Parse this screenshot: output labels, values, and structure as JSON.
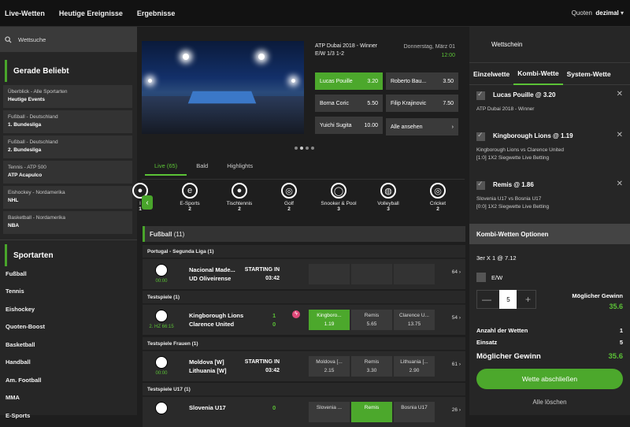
{
  "topnav": {
    "items": [
      "Live-Wetten",
      "Heutige Ereignisse",
      "Ergebnisse"
    ],
    "odds_label": "Quoten",
    "odds_value": "dezimal"
  },
  "sidebar": {
    "search_placeholder": "Wettsuche",
    "popular_title": "Gerade Beliebt",
    "popular": [
      {
        "sub": "Überblick - Alle Sportarten",
        "title": "Heutige Events"
      },
      {
        "sub": "Fußball - Deutschland",
        "title": "1. Bundesliga"
      },
      {
        "sub": "Fußball - Deutschland",
        "title": "2. Bundesliga"
      },
      {
        "sub": "Tennis - ATP 500",
        "title": "ATP Acapulco"
      },
      {
        "sub": "Eishockey - Nordamerika",
        "title": "NHL"
      },
      {
        "sub": "Basketball - Nordamerika",
        "title": "NBA"
      }
    ],
    "sports_title": "Sportarten",
    "sports": [
      "Fußball",
      "Tennis",
      "Eishockey",
      "Quoten-Boost",
      "Basketball",
      "Handball",
      "Am. Football",
      "MMA",
      "E-Sports"
    ]
  },
  "featured": {
    "title": "ATP Dubai 2018 - Winner",
    "subtitle": "E/W 1/3 1-2",
    "date": "Donnerstag, März 01",
    "time": "12:00",
    "odds": [
      {
        "name": "Lucas Pouille",
        "odd": "3.20"
      },
      {
        "name": "Roberto Bau...",
        "odd": "3.50"
      },
      {
        "name": "Borna Coric",
        "odd": "5.50"
      },
      {
        "name": "Filip Krajinovic",
        "odd": "7.50"
      },
      {
        "name": "Yuichi Sugita",
        "odd": "10.00"
      }
    ],
    "see_all": "Alle ansehen"
  },
  "tabs": [
    "Live (65)",
    "Bald",
    "Highlights"
  ],
  "sports_row": [
    {
      "name": "E-Sports",
      "count": "2"
    },
    {
      "name": "Tischtennis",
      "count": "2"
    },
    {
      "name": "Golf",
      "count": "2"
    },
    {
      "name": "Snooker & Pool",
      "count": "3"
    },
    {
      "name": "Volleyball",
      "count": "3"
    },
    {
      "name": "Cricket",
      "count": "2"
    }
  ],
  "sports_row_partial": {
    "name": "l",
    "count": "1"
  },
  "league": {
    "name": "Fußball",
    "count": "(11)"
  },
  "categories": [
    "Portugal - Segunda Liga (1)",
    "Testspiele (1)",
    "Testspiele Frauen (1)",
    "Testspiele U17 (1)"
  ],
  "matches": [
    {
      "home": "Nacional Made...",
      "away": "UD Oliveirense",
      "status1": "STARTING IN",
      "status2": "03:42",
      "clock": "00:00",
      "odds": [],
      "more": "64"
    },
    {
      "home": "Kingborough Lions",
      "away": "Clarence United",
      "score1": "1",
      "score2": "0",
      "clock": "2. HZ 66:15",
      "odds": [
        {
          "label": "Kingboro...",
          "odd": "1.19"
        },
        {
          "label": "Remis",
          "odd": "5.65"
        },
        {
          "label": "Clarence U...",
          "odd": "13.75"
        }
      ],
      "more": "54"
    },
    {
      "home": "Moldova [W]",
      "away": "Lithuania [W]",
      "status1": "STARTING IN",
      "status2": "03:42",
      "clock": "00:00",
      "odds": [
        {
          "label": "Moldova [...",
          "odd": "2.15"
        },
        {
          "label": "Remis",
          "odd": "3.30"
        },
        {
          "label": "Lithuania [...",
          "odd": "2.90"
        }
      ],
      "more": "61"
    },
    {
      "home": "Slovenia U17",
      "away": "",
      "score1": "0",
      "score2": "",
      "clock": "",
      "odds": [
        {
          "label": "Slovenia ...",
          "odd": ""
        },
        {
          "label": "Remis",
          "odd": ""
        },
        {
          "label": "Bosnia U17",
          "odd": ""
        }
      ],
      "more": "26"
    }
  ],
  "betslip": {
    "title": "Wettschein",
    "tabs": [
      "Einzelwette",
      "Kombi-Wette",
      "System-Wette"
    ],
    "bets": [
      {
        "name": "Lucas Pouille @ 3.20",
        "line1": "ATP Dubai 2018 - Winner",
        "line2": ""
      },
      {
        "name": "Kingborough Lions @ 1.19",
        "line1": "Kingborough Lions vs Clarence United",
        "line2": "[1:0] 1X2 Siegwette Live Betting"
      },
      {
        "name": "Remis @ 1.86",
        "line1": "Slovenia U17 vs Bosnia U17",
        "line2": "[0:0] 1X2 Siegwette Live Betting"
      }
    ],
    "options_title": "Kombi-Wetten Optionen",
    "combo": "3er X 1 @ 7.12",
    "ew_label": "E/W",
    "stake": "5",
    "possible_win_label": "Möglicher Gewinn",
    "possible_win": "35.6",
    "count_label": "Anzahl der Wetten",
    "count": "1",
    "stake_label": "Einsatz",
    "stake_total": "5",
    "total_win_label": "Möglicher Gewinn",
    "total_win": "35.6",
    "place_label": "Wette abschließen",
    "clear_label": "Alle löschen"
  }
}
